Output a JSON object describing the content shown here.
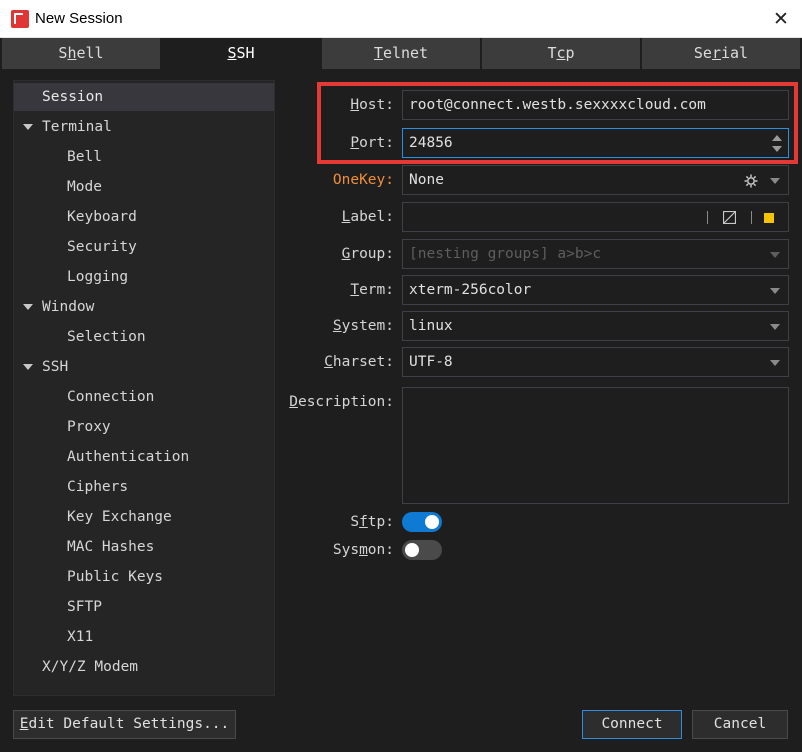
{
  "window": {
    "title": "New Session",
    "close_glyph": "✕"
  },
  "tabs": [
    {
      "label": "Shell",
      "active": false
    },
    {
      "label": "SSH",
      "active": true
    },
    {
      "label": "Telnet",
      "active": false
    },
    {
      "label": "Tcp",
      "active": false
    },
    {
      "label": "Serial",
      "active": false
    }
  ],
  "tree": {
    "items": [
      {
        "label": "Session",
        "selected": true
      },
      {
        "label": "Terminal",
        "expandable": true
      },
      {
        "label": "Bell"
      },
      {
        "label": "Mode"
      },
      {
        "label": "Keyboard"
      },
      {
        "label": "Security"
      },
      {
        "label": "Logging"
      },
      {
        "label": "Window",
        "expandable": true
      },
      {
        "label": "Selection"
      },
      {
        "label": "SSH",
        "expandable": true
      },
      {
        "label": "Connection"
      },
      {
        "label": "Proxy"
      },
      {
        "label": "Authentication"
      },
      {
        "label": "Ciphers"
      },
      {
        "label": "Key Exchange"
      },
      {
        "label": "MAC Hashes"
      },
      {
        "label": "Public Keys"
      },
      {
        "label": "SFTP"
      },
      {
        "label": "X11"
      },
      {
        "label": "X/Y/Z Modem"
      }
    ]
  },
  "form": {
    "host": {
      "label_pre": "",
      "label_key": "H",
      "label_post": "ost:",
      "value": "root@connect.westb.sexxxxcloud.com"
    },
    "port": {
      "label_pre": "",
      "label_key": "P",
      "label_post": "ort:",
      "value": "24856"
    },
    "onekey": {
      "label": "OneKey:",
      "value": "None",
      "icon": "gear-icon"
    },
    "label": {
      "label_pre": "",
      "label_key": "L",
      "label_post": "abel:",
      "value": "",
      "color_swatch": "#f5c400"
    },
    "group": {
      "label_pre": "",
      "label_key": "G",
      "label_post": "roup:",
      "placeholder": "[nesting groups] a>b>c"
    },
    "term": {
      "label_pre": "",
      "label_key": "T",
      "label_post": "erm:",
      "value": "xterm-256color"
    },
    "system": {
      "label_pre": "",
      "label_key": "S",
      "label_post": "ystem:",
      "value": "linux"
    },
    "charset": {
      "label_pre": "",
      "label_key": "C",
      "label_post": "harset:",
      "value": "UTF-8"
    },
    "description": {
      "label_pre": "",
      "label_key": "D",
      "label_post": "escription:",
      "value": ""
    },
    "sftp": {
      "label_pre": "S",
      "label_key": "f",
      "label_post": "tp:",
      "on": true
    },
    "sysmon": {
      "label_pre": "Sys",
      "label_key": "m",
      "label_post": "on:",
      "on": false
    }
  },
  "buttons": {
    "edit_defaults_key": "E",
    "edit_defaults_rest": "dit Default Settings...",
    "connect": "Connect",
    "cancel": "Cancel"
  },
  "colors": {
    "accent": "#0e7ad3",
    "highlight": "#e53935",
    "onekey_label": "#ef8e3b"
  }
}
